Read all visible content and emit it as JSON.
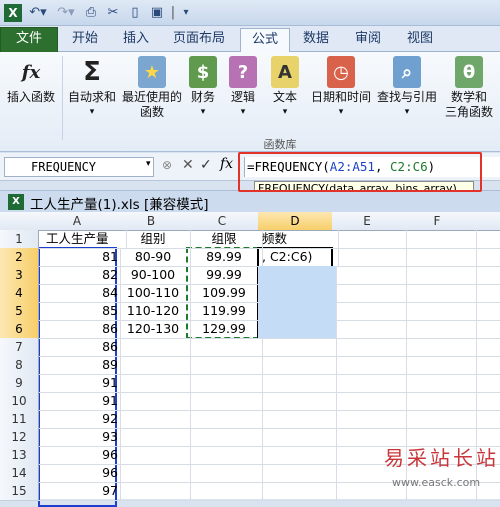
{
  "quick_access": {
    "sep": "|"
  },
  "tabs": [
    "文件",
    "开始",
    "插入",
    "页面布局",
    "公式",
    "数据",
    "审阅",
    "视图"
  ],
  "ribbon": {
    "buttons": [
      {
        "label": "插入函数",
        "label2": "",
        "icon": "fx"
      },
      {
        "label": "自动求和",
        "label2": "",
        "icon": "Σ"
      },
      {
        "label": "最近使用的",
        "label2": "函数",
        "icon": "★"
      },
      {
        "label": "财务",
        "label2": "",
        "icon": "$"
      },
      {
        "label": "逻辑",
        "label2": "",
        "icon": "?"
      },
      {
        "label": "文本",
        "label2": "",
        "icon": "A"
      },
      {
        "label": "日期和时间",
        "label2": "",
        "icon": "◷"
      },
      {
        "label": "查找与引用",
        "label2": "",
        "icon": "⌕"
      },
      {
        "label": "数学和",
        "label2": "三角函数",
        "icon": "θ"
      }
    ],
    "group_label": "函数库"
  },
  "formula_bar": {
    "name_box": "FREQUENCY",
    "formula_prefix": "=FREQUENCY(",
    "arg1": "A2:A51",
    "formula_mid": ", ",
    "arg2": "C2:C6",
    "formula_suffix": ")",
    "hint": "FREQUENCY(data_array, bins_array)"
  },
  "workbook": {
    "title": "工人生产量(1).xls  [兼容模式]"
  },
  "grid": {
    "columns": [
      "A",
      "B",
      "C",
      "D",
      "E",
      "F"
    ],
    "rows": [
      {
        "n": "1",
        "a": "工人生产量",
        "b": "组别",
        "c": "组限",
        "d": "频数"
      },
      {
        "n": "2",
        "a": "81",
        "b": "80-90",
        "c": "89.99",
        "d": ", C2:C6)"
      },
      {
        "n": "3",
        "a": "82",
        "b": "90-100",
        "c": "99.99",
        "d": ""
      },
      {
        "n": "4",
        "a": "84",
        "b": "100-110",
        "c": "109.99",
        "d": ""
      },
      {
        "n": "5",
        "a": "85",
        "b": "110-120",
        "c": "119.99",
        "d": ""
      },
      {
        "n": "6",
        "a": "86",
        "b": "120-130",
        "c": "129.99",
        "d": ""
      },
      {
        "n": "7",
        "a": "86",
        "b": "",
        "c": "",
        "d": ""
      },
      {
        "n": "8",
        "a": "89",
        "b": "",
        "c": "",
        "d": ""
      },
      {
        "n": "9",
        "a": "91",
        "b": "",
        "c": "",
        "d": ""
      },
      {
        "n": "10",
        "a": "91",
        "b": "",
        "c": "",
        "d": ""
      },
      {
        "n": "11",
        "a": "92",
        "b": "",
        "c": "",
        "d": ""
      },
      {
        "n": "12",
        "a": "93",
        "b": "",
        "c": "",
        "d": ""
      },
      {
        "n": "13",
        "a": "96",
        "b": "",
        "c": "",
        "d": ""
      },
      {
        "n": "14",
        "a": "96",
        "b": "",
        "c": "",
        "d": ""
      },
      {
        "n": "15",
        "a": "97",
        "b": "",
        "c": "",
        "d": ""
      }
    ]
  },
  "watermark": {
    "text": "易采站长站",
    "url": "www.easck.com"
  }
}
